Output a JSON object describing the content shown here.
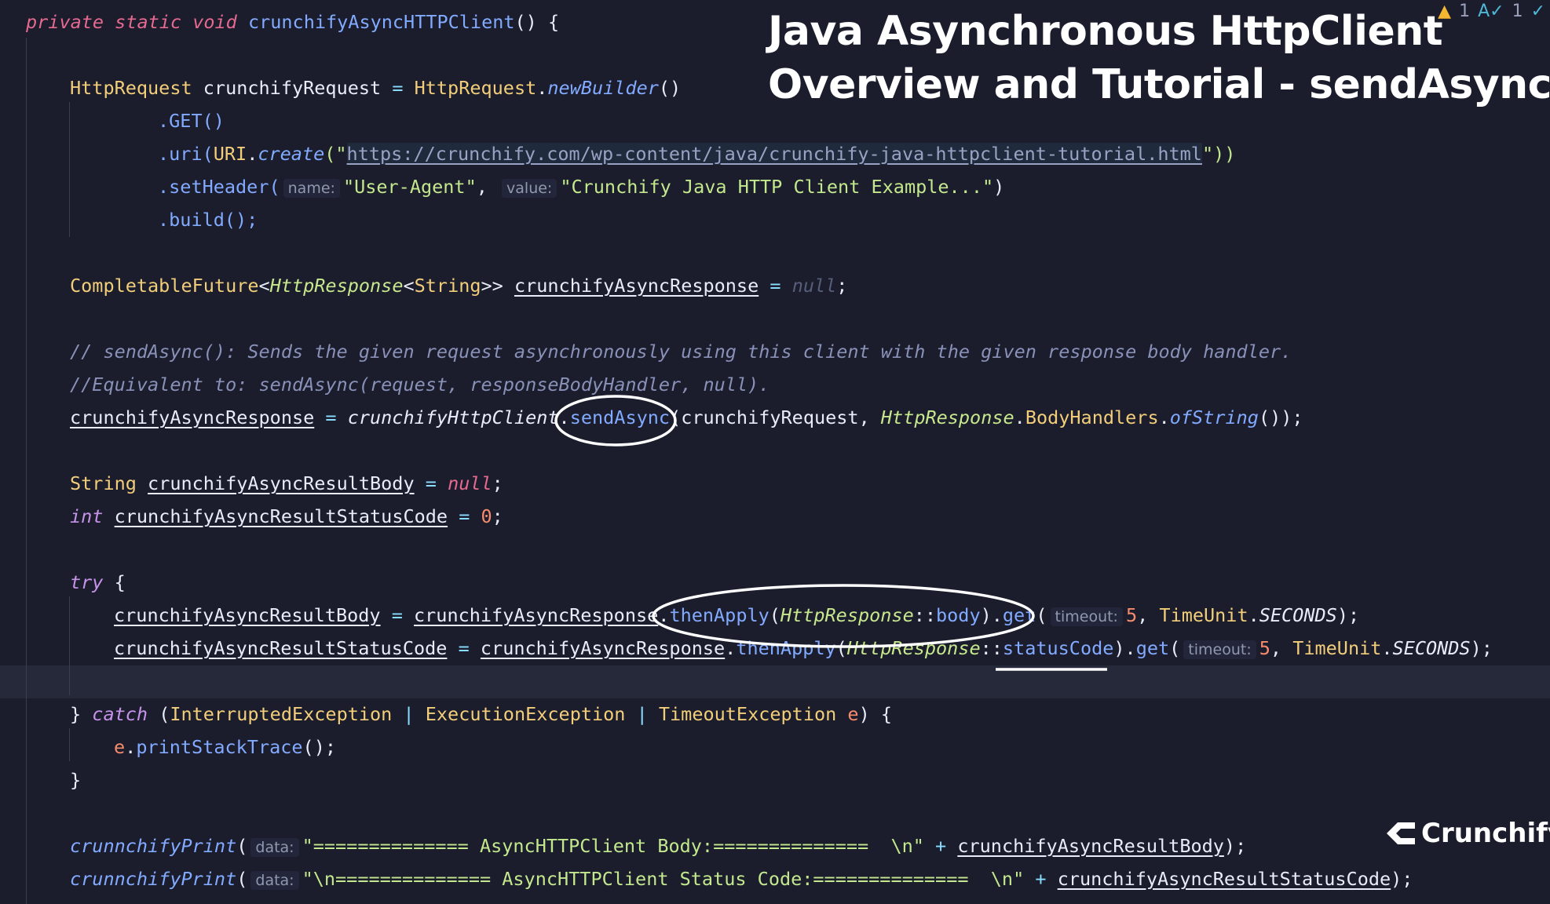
{
  "title": {
    "line1": "Java Asynchronous HttpClient",
    "line2": "Overview and Tutorial - sendAsync()"
  },
  "status_bar": {
    "warnings_count": "1",
    "typos_count": "1",
    "warning_icon": "warning-triangle-icon",
    "typo_icon": "spellcheck-icon"
  },
  "logo": {
    "text": "Crunchify",
    "icon": "crunchify-c-icon"
  },
  "colors": {
    "background": "#1b1d2c",
    "keyword": "#e6698f",
    "type": "#f2ce7a",
    "function": "#82aaff",
    "string": "#c3e88d",
    "number": "#f78c6c",
    "comment": "#8a91b8"
  },
  "code": {
    "l1": {
      "a": "private static void ",
      "b": "crunchifyAsyncHTTPClient",
      "c": "() {"
    },
    "l2": {
      "a": "HttpRequest",
      "b": " crunchifyRequest ",
      "c": "=",
      "d": " HttpRequest",
      "e": ".",
      "f": "newBuilder",
      "g": "()"
    },
    "l3": {
      "a": ".GET()"
    },
    "l4": {
      "a": ".uri(",
      "b": "URI",
      "c": ".",
      "d": "create",
      "e": "(\"",
      "f": "https://crunchify.com/wp-content/java/crunchify-java-httpclient-tutorial.html",
      "g": "\"))"
    },
    "l5": {
      "a": ".setHeader(",
      "hint1": "name:",
      "b": "\"User-Agent\"",
      "c": ",",
      "hint2": "value:",
      "d": "\"Crunchify Java HTTP Client Example...\"",
      "e": ")"
    },
    "l6": {
      "a": ".build();"
    },
    "l7": {
      "a": "CompletableFuture",
      "b": "<",
      "c": "HttpResponse",
      "d": "<",
      "e": "String",
      "f": ">> ",
      "g": "crunchifyAsyncResponse",
      "h": " = ",
      "i": "null",
      "j": ";"
    },
    "l8": {
      "a": "// sendAsync(): Sends the given request asynchronously using this client with the given response body handler."
    },
    "l9": {
      "a": "//Equivalent to: sendAsync(request, responseBodyHandler, null)."
    },
    "l10": {
      "a": "crunchifyAsyncResponse",
      "b": " = ",
      "c": "crunchifyHttpClient",
      "d": ".",
      "e": "sendAsync",
      "f": "(crunchifyRequest, ",
      "g": "HttpResponse",
      "h": ".",
      "i": "BodyHandlers",
      "j": ".",
      "k": "ofString",
      "l": "());"
    },
    "l11": {
      "a": "String",
      "b": " ",
      "c": "crunchifyAsyncResultBody",
      "d": " = ",
      "e": "null",
      "f": ";"
    },
    "l12": {
      "a": "int",
      "b": " ",
      "c": "crunchifyAsyncResultStatusCode",
      "d": " = ",
      "e": "0",
      "f": ";"
    },
    "l13": {
      "a": "try",
      "b": " {"
    },
    "l14": {
      "a": "crunchifyAsyncResultBody",
      "b": " = ",
      "c": "crunchifyAsyncResponse",
      "d": ".",
      "e": "thenApply",
      "f": "(",
      "g": "HttpResponse",
      "h": "::",
      "i": "body",
      "j": ").",
      "k": "get",
      "l": "(",
      "hint": "timeout:",
      "m": "5",
      "n": ", ",
      "o": "TimeUnit",
      "p": ".",
      "q": "SECONDS",
      "r": ");"
    },
    "l15": {
      "a": "crunchifyAsyncResultStatusCode",
      "b": " = ",
      "c": "crunchifyAsyncResponse",
      "d": ".",
      "e": "thenApply",
      "f": "(",
      "g": "HttpResponse",
      "h": "::",
      "i": "statusCode",
      "j": ").",
      "k": "get",
      "l": "(",
      "hint": "timeout:",
      "m": "5",
      "n": ", ",
      "o": "TimeUnit",
      "p": ".",
      "q": "SECONDS",
      "r": ");"
    },
    "l16": {
      "a": "} ",
      "b": "catch",
      "c": " (",
      "d": "InterruptedException",
      "e": " | ",
      "f": "ExecutionException",
      "g": " | ",
      "h": "TimeoutException",
      "i": " e",
      "j": ") {"
    },
    "l17": {
      "a": "e",
      "b": ".",
      "c": "printStackTrace",
      "d": "();"
    },
    "l18": {
      "a": "}"
    },
    "l19": {
      "a": "crunnchifyPrint",
      "b": "(",
      "hint": "data:",
      "c": "\"============== AsyncHTTPClient Body:==============  \\n\"",
      "d": " + ",
      "e": "crunchifyAsyncResultBody",
      "f": ");"
    },
    "l20": {
      "a": "crunnchifyPrint",
      "b": "(",
      "hint": "data:",
      "c": "\"\\n============== AsyncHTTPClient Status Code:==============  \\n\"",
      "d": " + ",
      "e": "crunchifyAsyncResultStatusCode",
      "f": ");"
    }
  }
}
